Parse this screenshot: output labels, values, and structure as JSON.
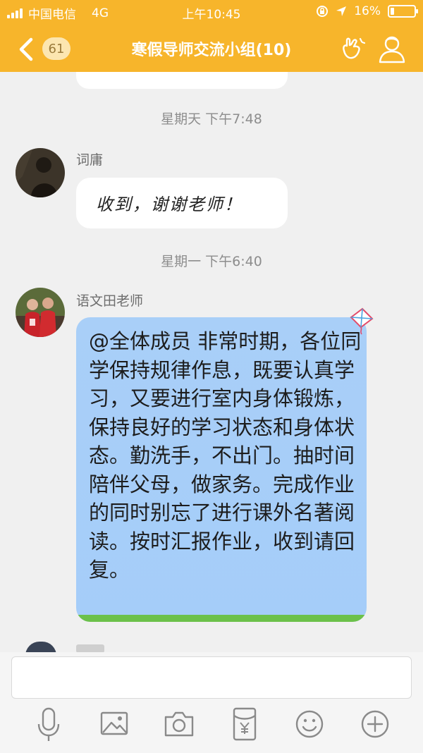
{
  "status_bar": {
    "carrier": "中国电信",
    "network": "4G",
    "time": "上午10:45",
    "battery": "16%",
    "battery_level": 0.16
  },
  "header": {
    "back_count": "61",
    "title": "寒假导师交流小组(10)"
  },
  "messages": [
    {
      "date": "星期天 下午7:48",
      "sender": "词庸",
      "text": "收到，谢谢老师！"
    },
    {
      "date": "星期一 下午6:40",
      "sender": "语文田老师",
      "text": "@全体成员 非常时期，各位同学保持规律作息，既要认真学习，又要进行室内身体锻炼，保持良好的学习状态和身体状态。勤洗手，不出门。抽时间陪伴父母，做家务。完成作业的同时别忘了进行课外名著阅读。按时汇报作业，收到请回复。"
    }
  ],
  "input": {
    "value": "",
    "placeholder": ""
  },
  "toolbar": {
    "icons": [
      "microphone-icon",
      "image-icon",
      "camera-icon",
      "red-packet-icon",
      "emoji-icon",
      "plus-icon"
    ]
  },
  "colors": {
    "header": "#f7b52b",
    "bubble_blue": "#a5cdf9",
    "background": "#f0f0f0"
  }
}
